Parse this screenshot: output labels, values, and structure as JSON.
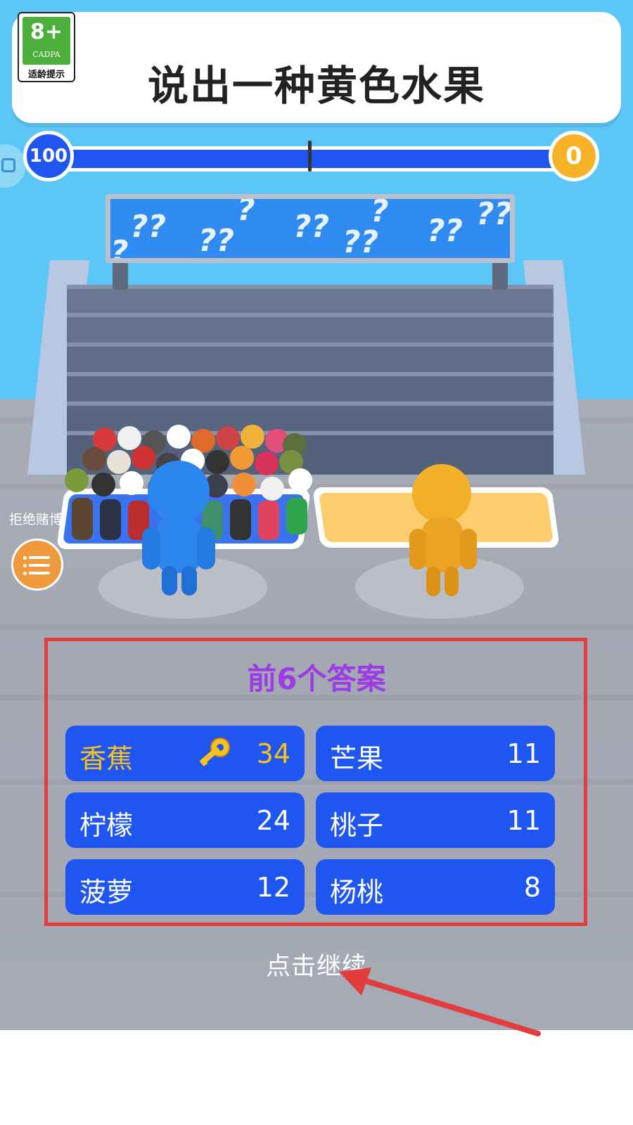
{
  "age_rating": {
    "badge": "8+",
    "org": "CADPA",
    "tip": "适龄提示"
  },
  "question": "说出一种黄色水果",
  "score": {
    "left": "100",
    "right": "0"
  },
  "sidebar": {
    "refuse_gambling": "拒绝赌博"
  },
  "answers": {
    "title": "前6个答案",
    "items": [
      {
        "answer": "香蕉",
        "count": "34",
        "revealed": true
      },
      {
        "answer": "芒果",
        "count": "11",
        "revealed": false
      },
      {
        "answer": "柠檬",
        "count": "24",
        "revealed": false
      },
      {
        "answer": "桃子",
        "count": "11",
        "revealed": false
      },
      {
        "answer": "菠萝",
        "count": "12",
        "revealed": false
      },
      {
        "answer": "杨桃",
        "count": "8",
        "revealed": false
      }
    ]
  },
  "continue_label": "点击继续",
  "colors": {
    "accent_blue": "#1f56f2",
    "accent_orange": "#f7b325",
    "title_purple": "#9b3de2",
    "highlight_red": "#e33c3c"
  }
}
